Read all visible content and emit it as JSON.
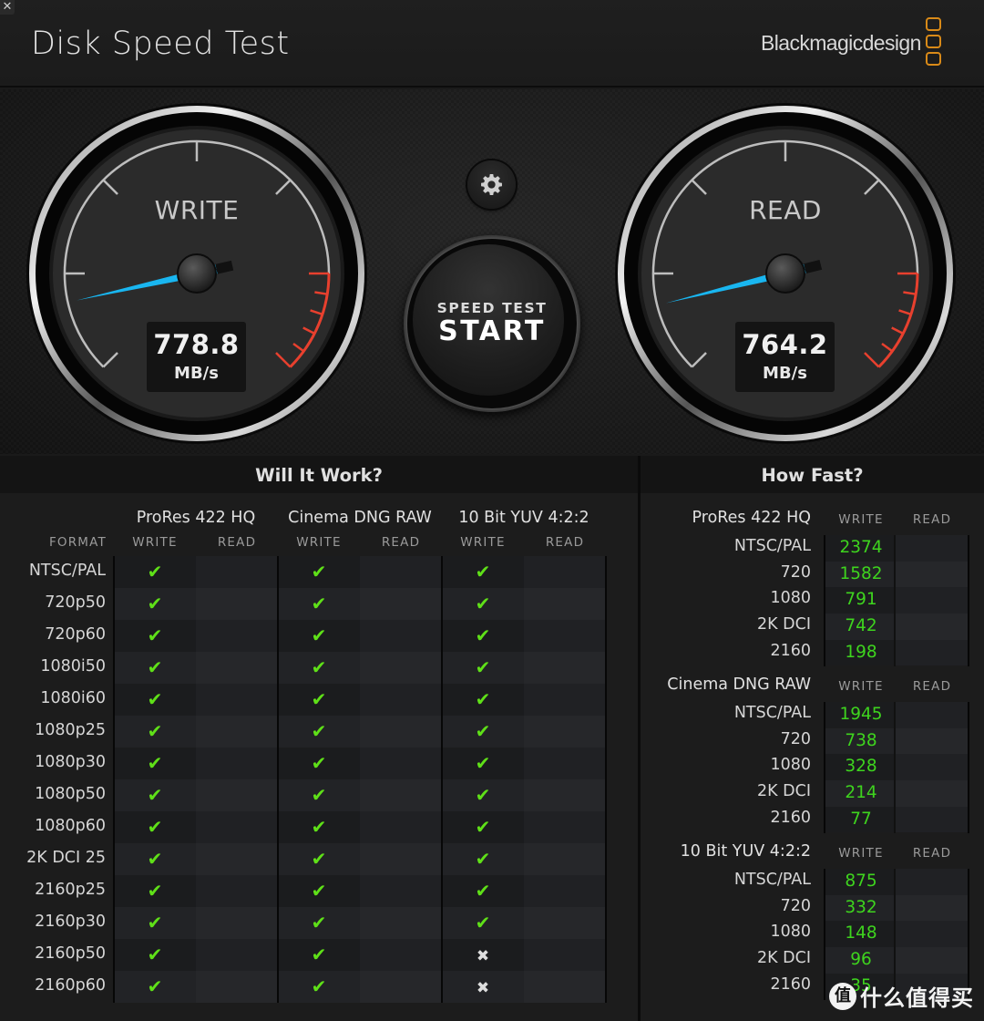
{
  "window": {
    "close_glyph": "✕",
    "title": "Disk Speed Test",
    "brand": "Blackmagicdesign"
  },
  "gauges": {
    "write": {
      "label": "WRITE",
      "value": "778.8",
      "unit": "MB/s",
      "needle_fraction": 0.12
    },
    "read": {
      "label": "READ",
      "value": "764.2",
      "unit": "MB/s",
      "needle_fraction": 0.115
    },
    "needle_color": "#19b6f0",
    "redline_color": "#e8402e"
  },
  "controls": {
    "settings_icon": "gear-icon",
    "start_sub": "SPEED TEST",
    "start_main": "START"
  },
  "will_it_work": {
    "title": "Will It Work?",
    "format_header": "FORMAT",
    "codecs": [
      "ProRes 422 HQ",
      "Cinema DNG RAW",
      "10 Bit YUV 4:2:2"
    ],
    "subcols": [
      "WRITE",
      "READ"
    ],
    "rows": [
      {
        "format": "NTSC/PAL",
        "results": [
          "ok",
          "",
          "ok",
          "",
          "ok",
          ""
        ]
      },
      {
        "format": "720p50",
        "results": [
          "ok",
          "",
          "ok",
          "",
          "ok",
          ""
        ]
      },
      {
        "format": "720p60",
        "results": [
          "ok",
          "",
          "ok",
          "",
          "ok",
          ""
        ]
      },
      {
        "format": "1080i50",
        "results": [
          "ok",
          "",
          "ok",
          "",
          "ok",
          ""
        ]
      },
      {
        "format": "1080i60",
        "results": [
          "ok",
          "",
          "ok",
          "",
          "ok",
          ""
        ]
      },
      {
        "format": "1080p25",
        "results": [
          "ok",
          "",
          "ok",
          "",
          "ok",
          ""
        ]
      },
      {
        "format": "1080p30",
        "results": [
          "ok",
          "",
          "ok",
          "",
          "ok",
          ""
        ]
      },
      {
        "format": "1080p50",
        "results": [
          "ok",
          "",
          "ok",
          "",
          "ok",
          ""
        ]
      },
      {
        "format": "1080p60",
        "results": [
          "ok",
          "",
          "ok",
          "",
          "ok",
          ""
        ]
      },
      {
        "format": "2K DCI 25",
        "results": [
          "ok",
          "",
          "ok",
          "",
          "ok",
          ""
        ]
      },
      {
        "format": "2160p25",
        "results": [
          "ok",
          "",
          "ok",
          "",
          "ok",
          ""
        ]
      },
      {
        "format": "2160p30",
        "results": [
          "ok",
          "",
          "ok",
          "",
          "ok",
          ""
        ]
      },
      {
        "format": "2160p50",
        "results": [
          "ok",
          "",
          "ok",
          "",
          "fail",
          ""
        ]
      },
      {
        "format": "2160p60",
        "results": [
          "ok",
          "",
          "ok",
          "",
          "fail",
          ""
        ]
      }
    ],
    "check_glyph": "✔",
    "cross_glyph": "✖"
  },
  "how_fast": {
    "title": "How Fast?",
    "subcols": [
      "WRITE",
      "READ"
    ],
    "groups": [
      {
        "codec": "ProRes 422 HQ",
        "rows": [
          {
            "label": "NTSC/PAL",
            "write": "2374",
            "read": ""
          },
          {
            "label": "720",
            "write": "1582",
            "read": ""
          },
          {
            "label": "1080",
            "write": "791",
            "read": ""
          },
          {
            "label": "2K DCI",
            "write": "742",
            "read": ""
          },
          {
            "label": "2160",
            "write": "198",
            "read": ""
          }
        ]
      },
      {
        "codec": "Cinema DNG RAW",
        "rows": [
          {
            "label": "NTSC/PAL",
            "write": "1945",
            "read": ""
          },
          {
            "label": "720",
            "write": "738",
            "read": ""
          },
          {
            "label": "1080",
            "write": "328",
            "read": ""
          },
          {
            "label": "2K DCI",
            "write": "214",
            "read": ""
          },
          {
            "label": "2160",
            "write": "77",
            "read": ""
          }
        ]
      },
      {
        "codec": "10 Bit YUV 4:2:2",
        "rows": [
          {
            "label": "NTSC/PAL",
            "write": "875",
            "read": ""
          },
          {
            "label": "720",
            "write": "332",
            "read": ""
          },
          {
            "label": "1080",
            "write": "148",
            "read": ""
          },
          {
            "label": "2K DCI",
            "write": "96",
            "read": ""
          },
          {
            "label": "2160",
            "write": "35",
            "read": ""
          }
        ]
      }
    ]
  },
  "watermark": {
    "badge": "值",
    "text": "什么值得买"
  }
}
